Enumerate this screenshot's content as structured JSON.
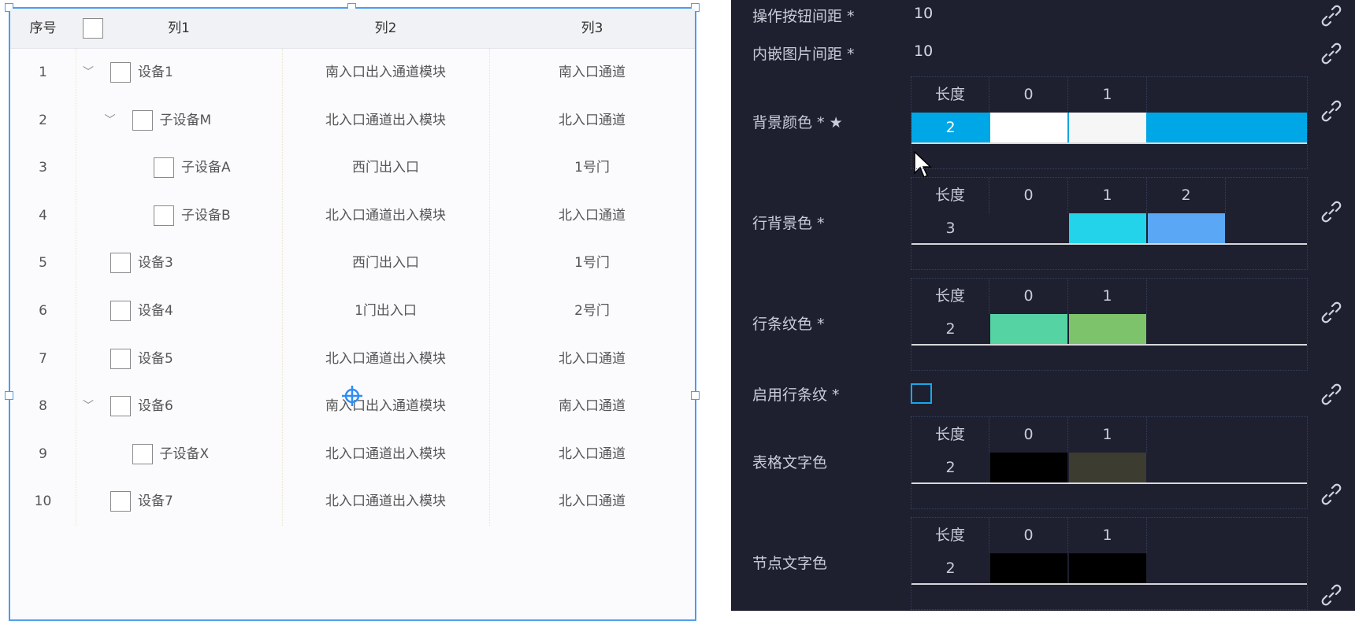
{
  "table": {
    "headers": {
      "seq": "序号",
      "col1": "列1",
      "col2": "列2",
      "col3": "列3"
    },
    "rows": [
      {
        "seq": "1",
        "name": "设备1",
        "level": 0,
        "expandable": true,
        "col2": "南入口出入通道模块",
        "col3": "南入口通道"
      },
      {
        "seq": "2",
        "name": "子设备M",
        "level": 1,
        "expandable": true,
        "col2": "北入口通道出入模块",
        "col3": "北入口通道"
      },
      {
        "seq": "3",
        "name": "子设备A",
        "level": 2,
        "expandable": false,
        "col2": "西门出入口",
        "col3": "1号门"
      },
      {
        "seq": "4",
        "name": "子设备B",
        "level": 2,
        "expandable": false,
        "col2": "北入口通道出入模块",
        "col3": "北入口通道"
      },
      {
        "seq": "5",
        "name": "设备3",
        "level": 0,
        "expandable": false,
        "col2": "西门出入口",
        "col3": "1号门"
      },
      {
        "seq": "6",
        "name": "设备4",
        "level": 0,
        "expandable": false,
        "col2": "1门出入口",
        "col3": "2号门"
      },
      {
        "seq": "7",
        "name": "设备5",
        "level": 0,
        "expandable": false,
        "col2": "北入口通道出入模块",
        "col3": "北入口通道"
      },
      {
        "seq": "8",
        "name": "设备6",
        "level": 0,
        "expandable": true,
        "col2": "南入口出入通道模块",
        "col3": "南入口通道"
      },
      {
        "seq": "9",
        "name": "子设备X",
        "level": 1,
        "expandable": false,
        "col2": "北入口通道出入模块",
        "col3": "北入口通道"
      },
      {
        "seq": "10",
        "name": "设备7",
        "level": 0,
        "expandable": false,
        "col2": "北入口通道出入模块",
        "col3": "北入口通道"
      }
    ]
  },
  "panel": {
    "button_spacing": {
      "label": "操作按钮间距 *",
      "value": "10"
    },
    "image_spacing": {
      "label": "内嵌图片间距 *",
      "value": "10"
    },
    "enable_stripe": {
      "label": "启用行条纹 *",
      "checked": false
    },
    "length_label": "长度",
    "color_props": [
      {
        "label": "背景颜色 * ★",
        "length": "2",
        "indices": [
          "0",
          "1"
        ],
        "colors": [
          "#ffffff",
          "#f6f6f6"
        ],
        "length_bg": "#00a7e6",
        "fill_bg": "#00a7e6"
      },
      {
        "label": "行背景色 *",
        "length": "3",
        "indices": [
          "0",
          "1",
          "2"
        ],
        "colors": [
          "",
          "#22d3ea",
          "#5aa7f5"
        ]
      },
      {
        "label": "行条纹色 *",
        "length": "2",
        "indices": [
          "0",
          "1"
        ],
        "colors": [
          "#55d3a3",
          "#7cc36b"
        ]
      },
      {
        "label": "表格文字色",
        "length": "2",
        "indices": [
          "0",
          "1"
        ],
        "colors": [
          "#000000",
          "#3c3c30"
        ]
      },
      {
        "label": "节点文字色",
        "length": "2",
        "indices": [
          "0",
          "1"
        ],
        "colors": [
          "#000000",
          "#000000"
        ]
      }
    ]
  }
}
